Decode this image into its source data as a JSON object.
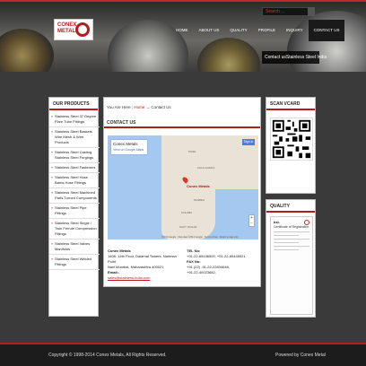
{
  "search": {
    "placeholder": "Search ..."
  },
  "brand": {
    "line1": "CONEX",
    "line2": "METAL"
  },
  "nav": [
    {
      "label": "HOME"
    },
    {
      "label": "ABOUT US"
    },
    {
      "label": "QUALITY"
    },
    {
      "label": "PROFILE"
    },
    {
      "label": "INQUIRY"
    },
    {
      "label": "CONTACT US"
    }
  ],
  "tagline": "Contact usStainless Steel India",
  "sidebar": {
    "title": "OUR PRODUCTS",
    "items": [
      "Stainless Steel 37 Degree Flare Tube Fittings",
      "Stainless Steel Baskets Wire Mesh & Wire Products",
      "Stainless Steel Casting Stainless Steel Forgings",
      "Stainless Steel Fasteners",
      "Stainless Steel Hose Barbs Hose Fittings",
      "Stainless Steel Machined Parts Turned Components",
      "Stainless Steel Pipe Fittings",
      "Stainless Steel Single / Twin Ferrule Compression Fittings",
      "Stainless Steel Valves Manifolds",
      "Stainless Steel Welded Fittings"
    ]
  },
  "breadcrumb": {
    "you_are_here": "You Are Here :",
    "home": "Home",
    "sep": "→",
    "current": "Contact Us"
  },
  "content": {
    "title": "CONTACT US"
  },
  "map": {
    "card_title": "Conex Metals",
    "card_link": "View on Google Maps",
    "signin": "Sign in",
    "pin_label": "Conex Metals",
    "places": [
      "PUNE",
      "KALA GHODA",
      "MUMBAI",
      "COLABA",
      "NAVY NAGAR"
    ],
    "footer": "©2014 Google · Map data ©2014 Google · Terms of Use · Report a map error"
  },
  "address": {
    "name": "Conex Metals",
    "line1": "1408, 14th Floor, Dalamal Towers, Nariman Point",
    "line2": "Navi Mumbai, Maharashtra 400021",
    "email_label": "Email:-",
    "email": "sales@stainless-india.com"
  },
  "phone": {
    "tel_label": "TEL No:",
    "tel": "+91-22-65446500, +91-22-65446521",
    "fax_label": "FAX No:",
    "fax": "+91 (22) -91-22-22834646,",
    "fax2": "+91-22-40023682,"
  },
  "scan": {
    "title": "SCAN VCARD"
  },
  "quality": {
    "title": "QUALITY",
    "cert_logo": "bsi.",
    "cert_title": "Certificate of Registration"
  },
  "footer": {
    "copyright": "Copyright © 1998-2014 Conex Metals, All Rights Reserved.",
    "powered": "Powered by Conex Metal"
  },
  "colors": {
    "accent": "#b01e1e",
    "dark": "#1c1c1c",
    "map_water": "#a4c8ef",
    "map_land": "#e8e3d6"
  }
}
